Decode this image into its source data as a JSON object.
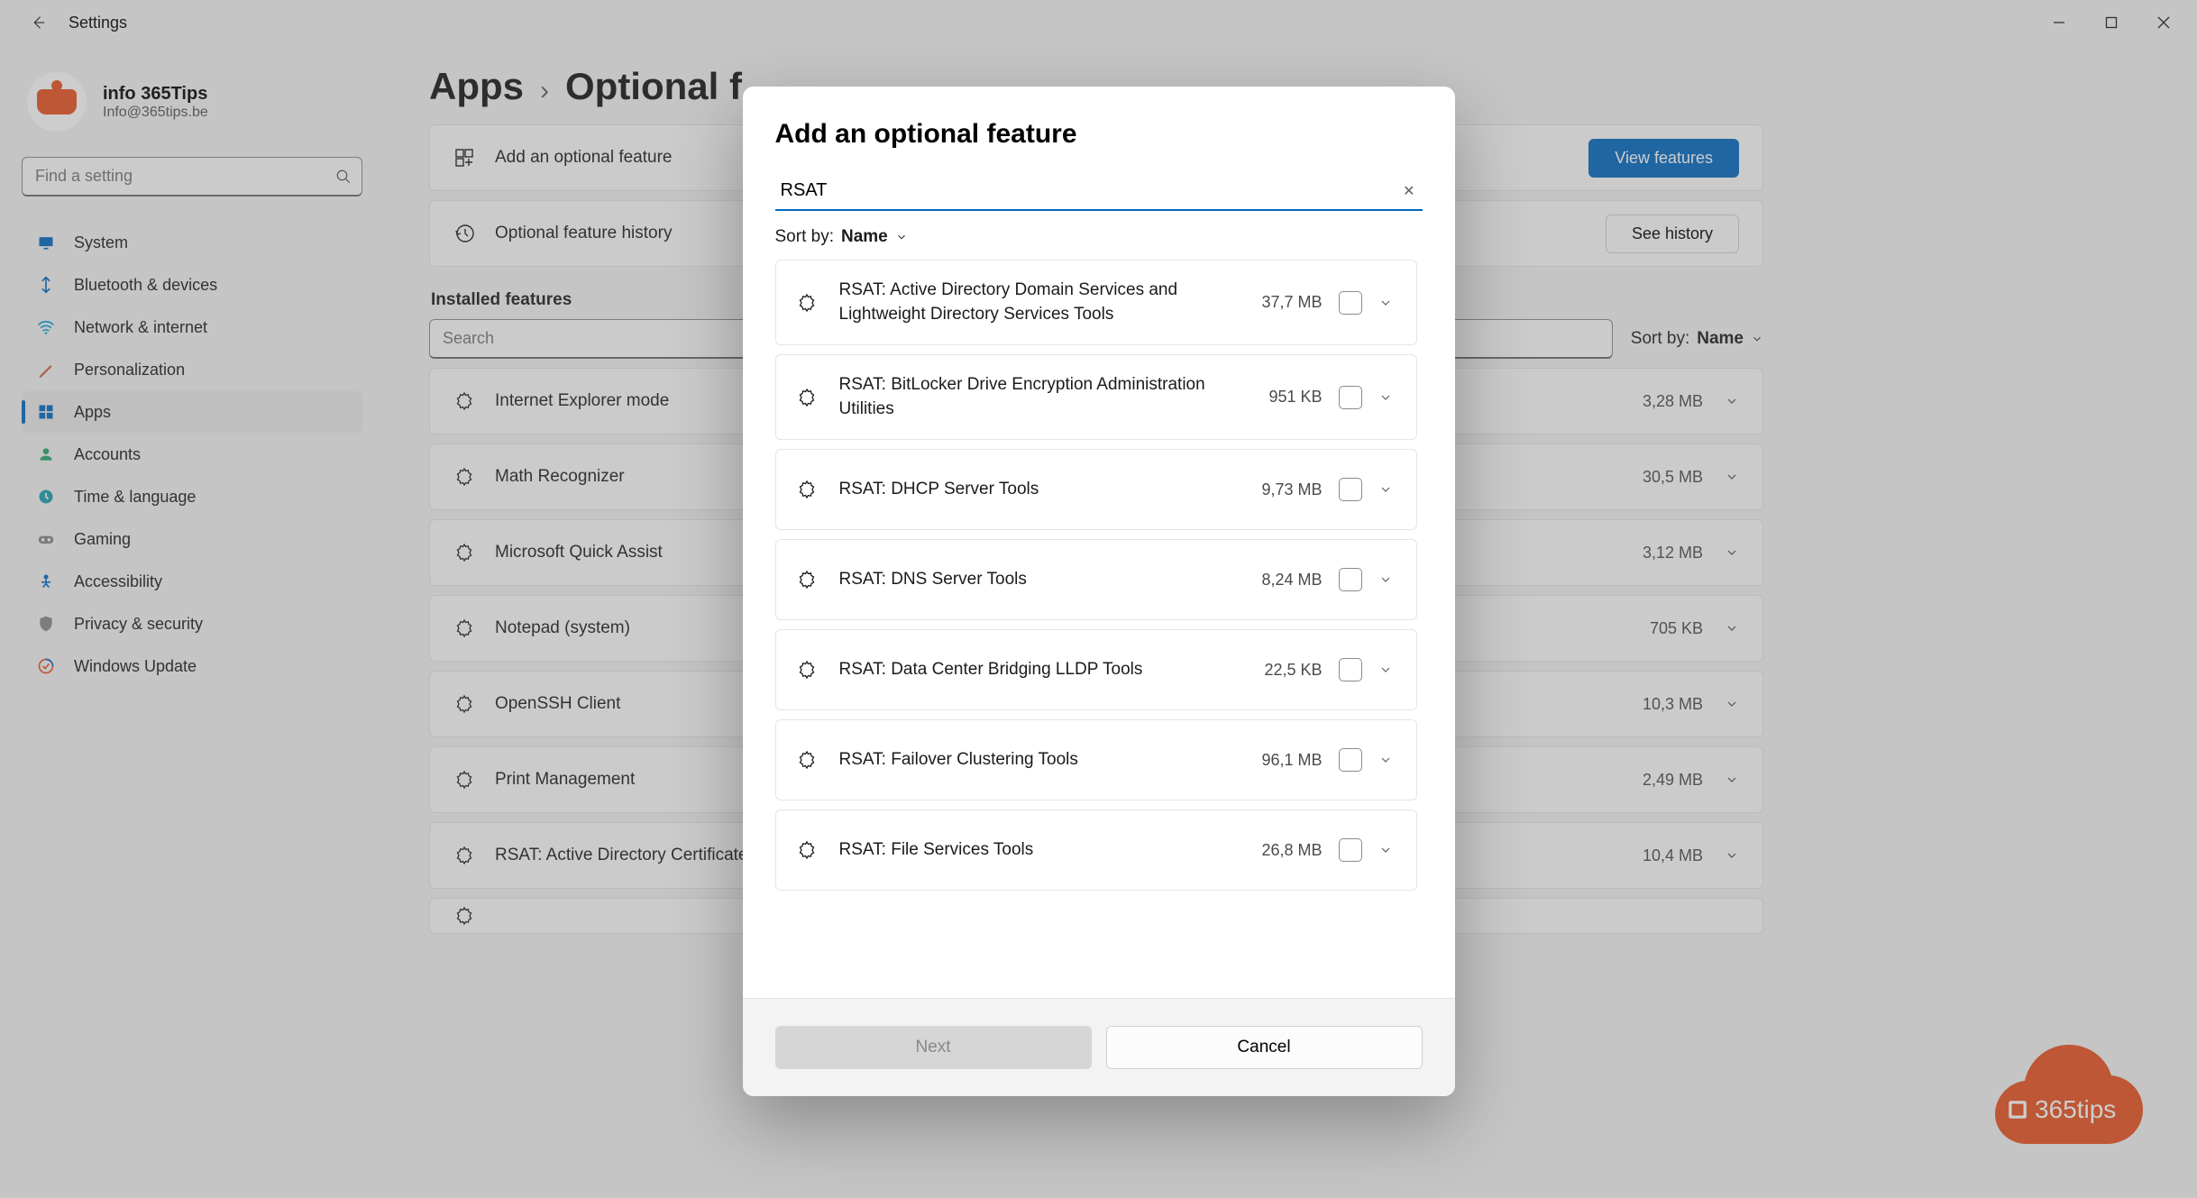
{
  "window": {
    "title": "Settings"
  },
  "profile": {
    "display_name": "info 365Tips",
    "email": "Info@365tips.be"
  },
  "sidebar": {
    "search_placeholder": "Find a setting",
    "items": [
      {
        "label": "System",
        "color": "#0067c0"
      },
      {
        "label": "Bluetooth & devices",
        "color": "#0067c0"
      },
      {
        "label": "Network & internet",
        "color": "#0aa2e4"
      },
      {
        "label": "Personalization",
        "color": "#c66a4a"
      },
      {
        "label": "Apps",
        "color": "#0067c0",
        "selected": true
      },
      {
        "label": "Accounts",
        "color": "#29a56a"
      },
      {
        "label": "Time & language",
        "color": "#1a9fb0"
      },
      {
        "label": "Gaming",
        "color": "#888888"
      },
      {
        "label": "Accessibility",
        "color": "#0067c0"
      },
      {
        "label": "Privacy & security",
        "color": "#8a8a8a"
      },
      {
        "label": "Windows Update",
        "color": "#e8521f"
      }
    ]
  },
  "breadcrumb": {
    "root": "Apps",
    "current": "Optional f…"
  },
  "header_cards": {
    "add": {
      "label": "Add an optional feature",
      "button": "View features"
    },
    "history": {
      "label": "Optional feature history",
      "button": "See history"
    }
  },
  "installed": {
    "title": "Installed features",
    "search_placeholder": "Search",
    "sort_label": "Sort by:",
    "sort_value": "Name",
    "items": [
      {
        "name": "Internet Explorer mode",
        "size": "3,28 MB"
      },
      {
        "name": "Math Recognizer",
        "size": "30,5 MB"
      },
      {
        "name": "Microsoft Quick Assist",
        "size": "3,12 MB"
      },
      {
        "name": "Notepad (system)",
        "size": "705 KB"
      },
      {
        "name": "OpenSSH Client",
        "size": "10,3 MB"
      },
      {
        "name": "Print Management",
        "size": "2,49 MB"
      },
      {
        "name": "RSAT: Active Directory Certificate Services Tools",
        "size": "10,4 MB"
      }
    ]
  },
  "modal": {
    "title": "Add an optional feature",
    "search_value": "RSAT",
    "sort_label": "Sort by:",
    "sort_value": "Name",
    "next": "Next",
    "cancel": "Cancel",
    "items": [
      {
        "name": "RSAT: Active Directory Domain Services and Lightweight Directory Services Tools",
        "size": "37,7 MB"
      },
      {
        "name": "RSAT: BitLocker Drive Encryption Administration Utilities",
        "size": "951 KB"
      },
      {
        "name": "RSAT: DHCP Server Tools",
        "size": "9,73 MB"
      },
      {
        "name": "RSAT: DNS Server Tools",
        "size": "8,24 MB"
      },
      {
        "name": "RSAT: Data Center Bridging LLDP Tools",
        "size": "22,5 KB"
      },
      {
        "name": "RSAT: Failover Clustering Tools",
        "size": "96,1 MB"
      },
      {
        "name": "RSAT: File Services Tools",
        "size": "26,8 MB"
      }
    ]
  },
  "watermark": {
    "text": "365tips"
  }
}
